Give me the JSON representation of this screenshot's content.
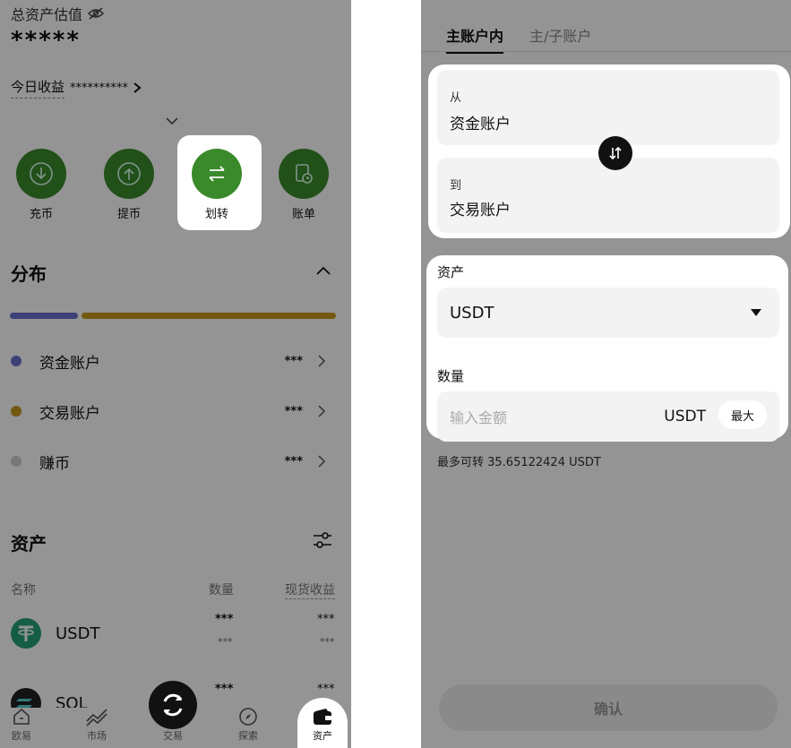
{
  "left": {
    "total_label": "总资产估值",
    "total_masked": "*****",
    "pnl_label": "今日收益",
    "pnl_masked": "**********",
    "actions": [
      {
        "label": "充币",
        "icon": "deposit-icon"
      },
      {
        "label": "提币",
        "icon": "withdraw-icon"
      },
      {
        "label": "划转",
        "icon": "transfer-icon"
      },
      {
        "label": "账单",
        "icon": "bill-icon"
      }
    ],
    "distribution": {
      "title": "分布",
      "bar": [
        {
          "fraction": 0.21,
          "color": "#6b6fd1"
        },
        {
          "fraction": 0.79,
          "color": "#c79a1c"
        }
      ],
      "rows": [
        {
          "label": "资金账户",
          "value": "***",
          "color": "#6b6fd1"
        },
        {
          "label": "交易账户",
          "value": "***",
          "color": "#c79a1c"
        },
        {
          "label": "赚币",
          "value": "***",
          "color": "#cfcfcf"
        }
      ]
    },
    "assets": {
      "title": "资产",
      "headers": {
        "name": "名称",
        "qty": "数量",
        "pnl": "现货收益"
      },
      "rows": [
        {
          "name": "USDT",
          "qty": "***",
          "qty_sub": "***",
          "pnl": "***",
          "pnl_sub": "***",
          "icon": "usdt-icon",
          "color": "#26a17b"
        },
        {
          "name": "SOL",
          "qty": "***",
          "pnl": "***",
          "icon": "sol-icon",
          "color": "#222"
        }
      ]
    },
    "nav": [
      {
        "label": "欧易",
        "icon": "home-icon"
      },
      {
        "label": "市场",
        "icon": "market-icon"
      },
      {
        "label": "交易",
        "icon": "trade-icon"
      },
      {
        "label": "探索",
        "icon": "explore-icon"
      },
      {
        "label": "资产",
        "icon": "wallet-icon"
      }
    ]
  },
  "right": {
    "tabs": [
      "主账户内",
      "主/子账户"
    ],
    "from_label": "从",
    "from_value": "资金账户",
    "to_label": "到",
    "to_value": "交易账户",
    "asset_label": "资产",
    "asset_value": "USDT",
    "amount_label": "数量",
    "amount_placeholder": "输入金额",
    "amount_unit": "USDT",
    "max_label": "最大",
    "max_available": "最多可转 35.65122424 USDT",
    "confirm_label": "确认"
  }
}
